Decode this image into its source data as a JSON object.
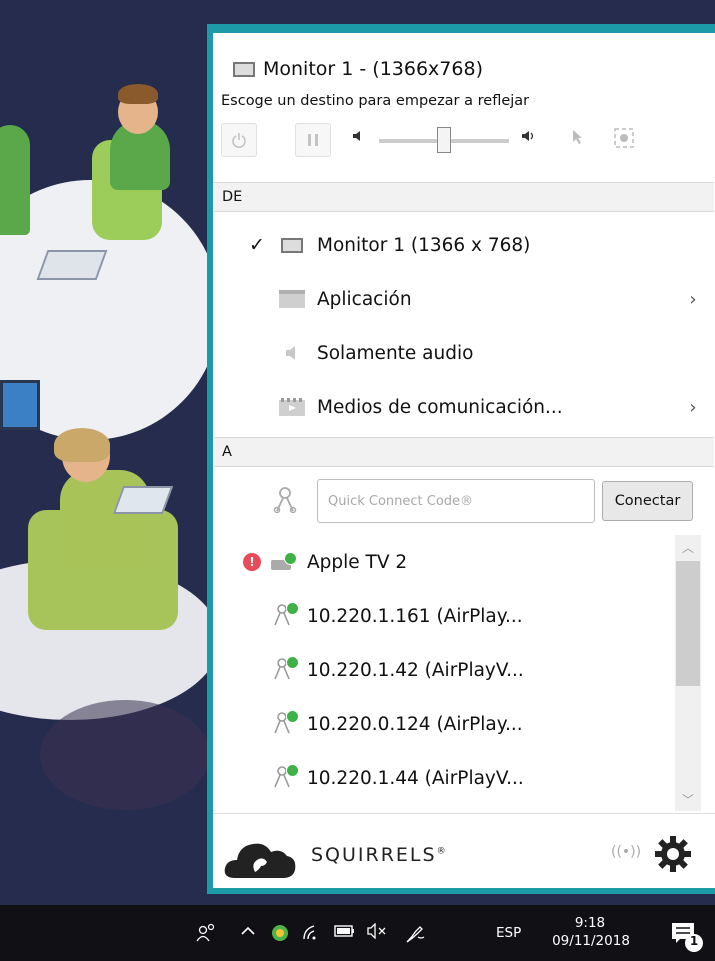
{
  "window": {
    "title": "Monitor 1 - (1366x768)",
    "subtitle": "Escoge un destino para empezar a reflejar"
  },
  "controls": {
    "power_icon": "power-icon",
    "pause_icon": "pause-icon",
    "volume_level": 0.45,
    "pointer_icon": "cursor-icon",
    "record_icon": "record-icon"
  },
  "source_section": {
    "header": "DE",
    "items": [
      {
        "label": "Monitor 1 (1366 x 768)",
        "selected": true,
        "icon": "monitor-icon",
        "has_submenu": false
      },
      {
        "label": "Aplicación",
        "selected": false,
        "icon": "application-icon",
        "has_submenu": true
      },
      {
        "label": "Solamente audio",
        "selected": false,
        "icon": "speaker-icon",
        "has_submenu": false
      },
      {
        "label": "Medios de comunicación...",
        "selected": false,
        "icon": "media-icon",
        "has_submenu": true
      }
    ]
  },
  "dest_section": {
    "header": "A",
    "quick_connect_placeholder": "Quick Connect Code®",
    "connect_label": "Conectar",
    "items": [
      {
        "label": "Apple TV 2",
        "warning": true,
        "icon": "apple-tv-icon"
      },
      {
        "label": "10.220.1.161 (AirPlay...",
        "warning": false,
        "icon": "airplay-icon"
      },
      {
        "label": "10.220.1.42 (AirPlayV...",
        "warning": false,
        "icon": "airplay-icon"
      },
      {
        "label": "10.220.0.124 (AirPlay...",
        "warning": false,
        "icon": "airplay-icon"
      },
      {
        "label": "10.220.1.44 (AirPlayV...",
        "warning": false,
        "icon": "airplay-icon"
      }
    ]
  },
  "footer": {
    "brand": "SQUIRRELS",
    "brand_mark": "®"
  },
  "taskbar": {
    "lang": "ESP",
    "time": "9:18",
    "date": "09/11/2018",
    "notification_count": "1"
  },
  "colors": {
    "panel_border": "#1c9aa8",
    "online_dot": "#3fb247",
    "warning": "#e84b57"
  }
}
